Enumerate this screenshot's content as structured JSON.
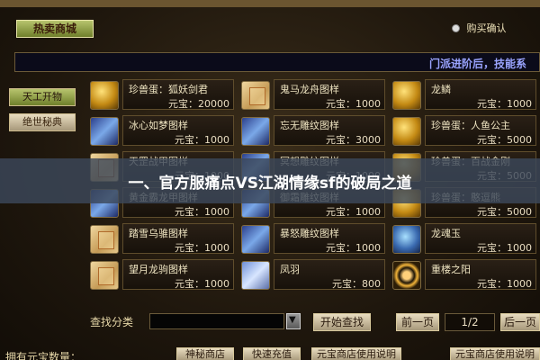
{
  "top": {
    "shop_tab": "热卖商城",
    "buy_confirm": "购买确认"
  },
  "notice": {
    "text": "门派进阶后，技能系"
  },
  "left_menu": {
    "items": [
      "天工开物",
      "绝世秘典"
    ],
    "active_index": 0
  },
  "grid": {
    "items": [
      {
        "name": "珍兽蛋：狐妖剑君",
        "price": "元宝：20000",
        "icon": "gold-egg-icon"
      },
      {
        "name": "鬼马龙舟图样",
        "price": "元宝：1000",
        "icon": "scroll-icon"
      },
      {
        "name": "龙鳞",
        "price": "元宝：1000",
        "icon": "dragon-scale-icon"
      },
      {
        "name": "冰心如梦图样",
        "price": "元宝：1000",
        "icon": "blue-scroll-icon"
      },
      {
        "name": "忘无雕纹图样",
        "price": "元宝：3000",
        "icon": "blue-scroll-icon"
      },
      {
        "name": "珍兽蛋：人鱼公主",
        "price": "元宝：5000",
        "icon": "gold-egg-icon"
      },
      {
        "name": "天罡战甲图样",
        "price": "元宝：1000",
        "icon": "scroll-icon"
      },
      {
        "name": "冥想雕纹图样",
        "price": "元宝：1000",
        "icon": "blue-scroll-icon"
      },
      {
        "name": "珍兽蛋：百战金刚",
        "price": "元宝：5000",
        "icon": "gold-egg-icon"
      },
      {
        "name": "黄金霸龙甲图样",
        "price": "元宝：1000",
        "icon": "blue-scroll-icon"
      },
      {
        "name": "御霜雕纹图样",
        "price": "元宝：1000",
        "icon": "blue-scroll-icon"
      },
      {
        "name": "珍兽蛋：憨逗熊",
        "price": "元宝：5000",
        "icon": "gold-egg-icon"
      },
      {
        "name": "踏雪乌骓图样",
        "price": "元宝：1000",
        "icon": "scroll-icon"
      },
      {
        "name": "暴怒雕纹图样",
        "price": "元宝：1000",
        "icon": "blue-scroll-icon"
      },
      {
        "name": "龙魂玉",
        "price": "元宝：1000",
        "icon": "orb-icon"
      },
      {
        "name": "望月龙驹图样",
        "price": "元宝：1000",
        "icon": "scroll-icon"
      },
      {
        "name": "凤羽",
        "price": "元宝：800",
        "icon": "feather-icon"
      },
      {
        "name": "重楼之阳",
        "price": "元宝：1000",
        "icon": "ring-icon"
      }
    ]
  },
  "banner": {
    "text": "一、官方服痛点VS江湖情缘sf的破局之道"
  },
  "search": {
    "label": "查找分类",
    "placeholder": "",
    "search_button": "开始查找",
    "prev_button": "前一页",
    "page_indicator": "1/2",
    "next_button": "后一页"
  },
  "footer": {
    "text": "拥有元宝数量：",
    "buttons": [
      "神秘商店",
      "快速充值",
      "元宝商店使用说明",
      "元宝商店使用说明"
    ]
  },
  "colors": {
    "accent_green": "#8a9a3a",
    "notice_blue": "#9aa4ff",
    "banner_overlay": "#3c485a"
  }
}
